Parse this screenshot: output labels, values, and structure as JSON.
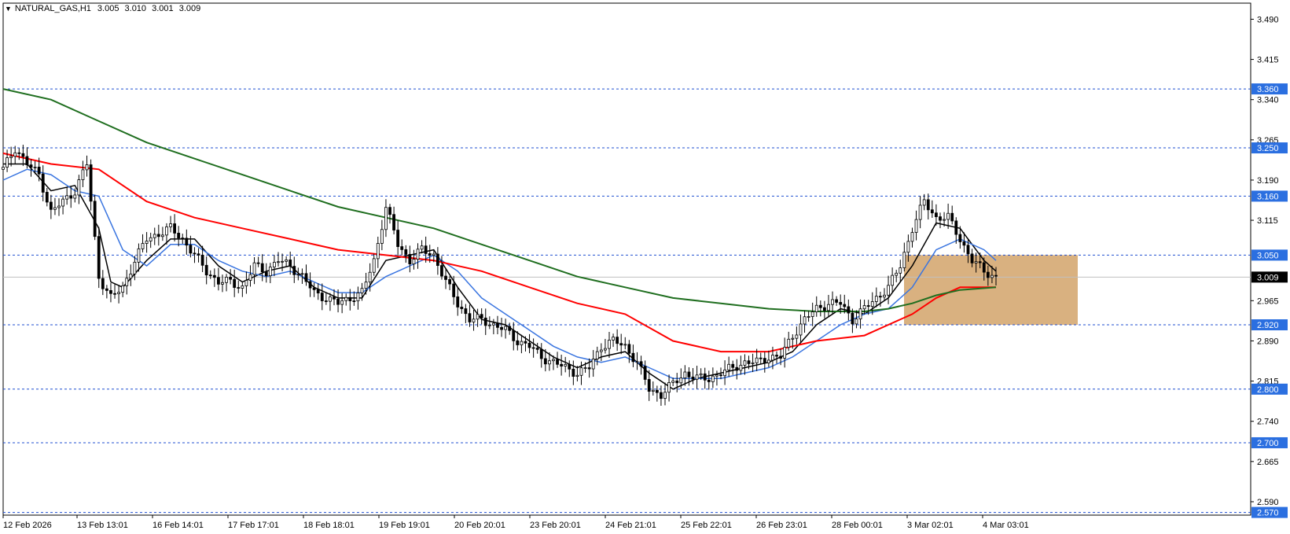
{
  "header": {
    "symbol": "NATURAL_GAS,H1",
    "open": "3.005",
    "high": "3.010",
    "low": "3.001",
    "close": "3.009"
  },
  "colors": {
    "background": "#ffffff",
    "frame": "#000000",
    "level_line": "#1f4fd0",
    "level_label_bg": "#2b6fe0",
    "current_price_label_bg": "#000000",
    "ma_black": "#000000",
    "ma_blue": "#3a75e0",
    "ma_red": "#ff0000",
    "ma_green": "#1f6e1f",
    "zone_fill": "#d2a36a"
  },
  "chart_data": {
    "type": "candlestick",
    "title": "",
    "ylim": [
      2.565,
      3.52
    ],
    "y_ticks": [
      "3.490",
      "3.415",
      "3.340",
      "3.265",
      "3.190",
      "3.115",
      "2.965",
      "2.890",
      "2.815",
      "2.740",
      "2.665",
      "2.590"
    ],
    "x_ticks": [
      "12 Feb 2026",
      "13 Feb 13:01",
      "16 Feb 14:01",
      "17 Feb 17:01",
      "18 Feb 18:01",
      "19 Feb 19:01",
      "20 Feb 20:01",
      "23 Feb 20:01",
      "24 Feb 21:01",
      "25 Feb 22:01",
      "26 Feb 23:01",
      "28 Feb 00:01",
      "3 Mar 02:01",
      "4 Mar 03:01"
    ],
    "horizontal_levels": [
      "3.360",
      "3.250",
      "3.160",
      "3.050",
      "2.920",
      "2.800",
      "2.700",
      "2.570"
    ],
    "current_price": "3.009",
    "zone": {
      "x_start": "3 Mar 02:01",
      "x_end": "4 Mar 03:01",
      "y_top": 3.05,
      "y_bottom": 2.92
    },
    "price_series": [
      [
        0,
        3.21
      ],
      [
        3,
        3.25
      ],
      [
        6,
        3.22
      ],
      [
        9,
        3.2
      ],
      [
        12,
        3.13
      ],
      [
        15,
        3.15
      ],
      [
        18,
        3.17
      ],
      [
        21,
        3.22
      ],
      [
        24,
        3.01
      ],
      [
        27,
        2.97
      ],
      [
        30,
        2.99
      ],
      [
        33,
        3.04
      ],
      [
        36,
        3.08
      ],
      [
        39,
        3.09
      ],
      [
        42,
        3.1
      ],
      [
        45,
        3.08
      ],
      [
        48,
        3.05
      ],
      [
        51,
        3.02
      ],
      [
        54,
        3.0
      ],
      [
        57,
        3.0
      ],
      [
        60,
        2.99
      ],
      [
        63,
        3.03
      ],
      [
        66,
        3.02
      ],
      [
        69,
        3.04
      ],
      [
        72,
        3.03
      ],
      [
        75,
        3.01
      ],
      [
        78,
        2.98
      ],
      [
        81,
        2.97
      ],
      [
        84,
        2.96
      ],
      [
        87,
        2.97
      ],
      [
        90,
        2.98
      ],
      [
        93,
        3.04
      ],
      [
        96,
        3.14
      ],
      [
        99,
        3.07
      ],
      [
        102,
        3.04
      ],
      [
        105,
        3.06
      ],
      [
        108,
        3.05
      ],
      [
        111,
        3.0
      ],
      [
        114,
        2.96
      ],
      [
        117,
        2.93
      ],
      [
        120,
        2.93
      ],
      [
        123,
        2.92
      ],
      [
        126,
        2.91
      ],
      [
        129,
        2.89
      ],
      [
        132,
        2.88
      ],
      [
        135,
        2.86
      ],
      [
        138,
        2.85
      ],
      [
        141,
        2.84
      ],
      [
        144,
        2.83
      ],
      [
        147,
        2.84
      ],
      [
        150,
        2.88
      ],
      [
        153,
        2.89
      ],
      [
        156,
        2.88
      ],
      [
        159,
        2.85
      ],
      [
        162,
        2.8
      ],
      [
        165,
        2.79
      ],
      [
        168,
        2.81
      ],
      [
        171,
        2.83
      ],
      [
        174,
        2.82
      ],
      [
        177,
        2.82
      ],
      [
        180,
        2.83
      ],
      [
        183,
        2.84
      ],
      [
        186,
        2.85
      ],
      [
        189,
        2.85
      ],
      [
        192,
        2.86
      ],
      [
        195,
        2.86
      ],
      [
        198,
        2.9
      ],
      [
        201,
        2.93
      ],
      [
        204,
        2.95
      ],
      [
        207,
        2.96
      ],
      [
        210,
        2.96
      ],
      [
        213,
        2.93
      ],
      [
        216,
        2.95
      ],
      [
        219,
        2.97
      ],
      [
        222,
        2.99
      ],
      [
        225,
        3.03
      ],
      [
        228,
        3.1
      ],
      [
        231,
        3.15
      ],
      [
        234,
        3.12
      ],
      [
        237,
        3.12
      ],
      [
        240,
        3.08
      ],
      [
        243,
        3.04
      ],
      [
        246,
        3.02
      ],
      [
        249,
        3.009
      ]
    ],
    "series": [
      {
        "color": "#000000",
        "values": [
          [
            0,
            3.22
          ],
          [
            6,
            3.22
          ],
          [
            12,
            3.17
          ],
          [
            18,
            3.18
          ],
          [
            24,
            3.1
          ],
          [
            27,
            3.0
          ],
          [
            30,
            2.99
          ],
          [
            36,
            3.04
          ],
          [
            42,
            3.08
          ],
          [
            48,
            3.08
          ],
          [
            54,
            3.03
          ],
          [
            60,
            3.0
          ],
          [
            66,
            3.02
          ],
          [
            72,
            3.03
          ],
          [
            78,
            2.99
          ],
          [
            84,
            2.97
          ],
          [
            90,
            2.97
          ],
          [
            96,
            3.04
          ],
          [
            102,
            3.05
          ],
          [
            108,
            3.06
          ],
          [
            114,
            2.99
          ],
          [
            120,
            2.93
          ],
          [
            126,
            2.92
          ],
          [
            132,
            2.89
          ],
          [
            138,
            2.86
          ],
          [
            144,
            2.84
          ],
          [
            150,
            2.86
          ],
          [
            156,
            2.87
          ],
          [
            162,
            2.83
          ],
          [
            168,
            2.8
          ],
          [
            174,
            2.82
          ],
          [
            180,
            2.83
          ],
          [
            186,
            2.84
          ],
          [
            192,
            2.85
          ],
          [
            198,
            2.87
          ],
          [
            204,
            2.92
          ],
          [
            210,
            2.95
          ],
          [
            216,
            2.94
          ],
          [
            222,
            2.97
          ],
          [
            228,
            3.03
          ],
          [
            234,
            3.11
          ],
          [
            240,
            3.1
          ],
          [
            246,
            3.04
          ],
          [
            249,
            3.02
          ]
        ]
      },
      {
        "color": "#3a75e0",
        "values": [
          [
            0,
            3.19
          ],
          [
            6,
            3.21
          ],
          [
            12,
            3.2
          ],
          [
            18,
            3.17
          ],
          [
            24,
            3.16
          ],
          [
            30,
            3.06
          ],
          [
            36,
            3.03
          ],
          [
            42,
            3.07
          ],
          [
            48,
            3.07
          ],
          [
            54,
            3.04
          ],
          [
            60,
            3.02
          ],
          [
            66,
            3.01
          ],
          [
            72,
            3.02
          ],
          [
            78,
            3.0
          ],
          [
            84,
            2.98
          ],
          [
            90,
            2.98
          ],
          [
            96,
            3.01
          ],
          [
            102,
            3.03
          ],
          [
            108,
            3.05
          ],
          [
            114,
            3.02
          ],
          [
            120,
            2.97
          ],
          [
            126,
            2.94
          ],
          [
            132,
            2.91
          ],
          [
            138,
            2.88
          ],
          [
            144,
            2.86
          ],
          [
            150,
            2.85
          ],
          [
            156,
            2.86
          ],
          [
            162,
            2.84
          ],
          [
            168,
            2.82
          ],
          [
            174,
            2.82
          ],
          [
            180,
            2.82
          ],
          [
            186,
            2.83
          ],
          [
            192,
            2.84
          ],
          [
            198,
            2.86
          ],
          [
            204,
            2.89
          ],
          [
            210,
            2.92
          ],
          [
            216,
            2.94
          ],
          [
            222,
            2.95
          ],
          [
            228,
            2.99
          ],
          [
            234,
            3.06
          ],
          [
            240,
            3.08
          ],
          [
            246,
            3.06
          ],
          [
            249,
            3.04
          ]
        ]
      },
      {
        "color": "#ff0000",
        "values": [
          [
            0,
            3.24
          ],
          [
            12,
            3.22
          ],
          [
            24,
            3.21
          ],
          [
            36,
            3.15
          ],
          [
            48,
            3.12
          ],
          [
            60,
            3.1
          ],
          [
            72,
            3.08
          ],
          [
            84,
            3.06
          ],
          [
            96,
            3.05
          ],
          [
            108,
            3.04
          ],
          [
            120,
            3.02
          ],
          [
            132,
            2.99
          ],
          [
            144,
            2.96
          ],
          [
            156,
            2.94
          ],
          [
            168,
            2.89
          ],
          [
            180,
            2.87
          ],
          [
            192,
            2.87
          ],
          [
            204,
            2.89
          ],
          [
            216,
            2.9
          ],
          [
            222,
            2.92
          ],
          [
            228,
            2.94
          ],
          [
            234,
            2.97
          ],
          [
            240,
            2.99
          ],
          [
            249,
            2.99
          ]
        ]
      },
      {
        "color": "#1f6e1f",
        "values": [
          [
            0,
            3.36
          ],
          [
            12,
            3.34
          ],
          [
            24,
            3.3
          ],
          [
            36,
            3.26
          ],
          [
            48,
            3.23
          ],
          [
            60,
            3.2
          ],
          [
            72,
            3.17
          ],
          [
            84,
            3.14
          ],
          [
            96,
            3.12
          ],
          [
            108,
            3.1
          ],
          [
            120,
            3.07
          ],
          [
            132,
            3.04
          ],
          [
            144,
            3.01
          ],
          [
            156,
            2.99
          ],
          [
            168,
            2.97
          ],
          [
            180,
            2.96
          ],
          [
            192,
            2.95
          ],
          [
            204,
            2.945
          ],
          [
            216,
            2.945
          ],
          [
            222,
            2.95
          ],
          [
            228,
            2.96
          ],
          [
            234,
            2.975
          ],
          [
            240,
            2.985
          ],
          [
            249,
            2.99
          ]
        ]
      }
    ]
  }
}
